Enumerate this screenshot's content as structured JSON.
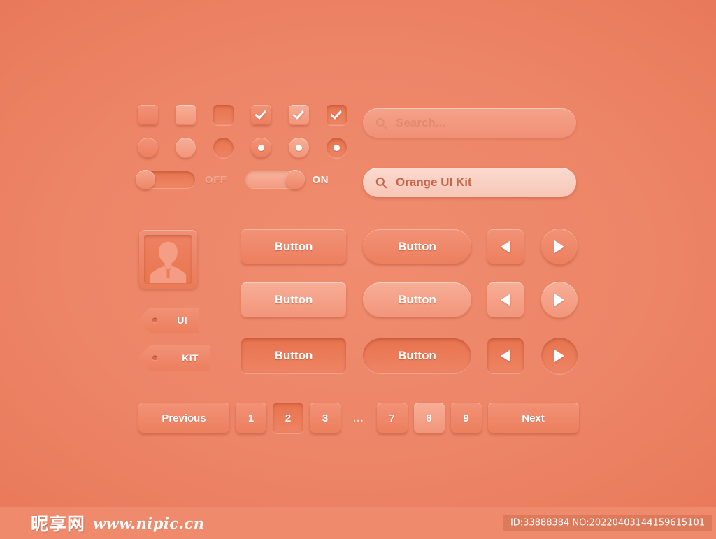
{
  "theme": {
    "background": "#ED8567",
    "surface_normal": "#F08B6D",
    "surface_light": "#F5A189",
    "surface_pressed": "#E8734F",
    "text_on_surface": "#FFFFFF",
    "text_muted": "#E08C72",
    "text_accent": "#C4654A",
    "field_filled_bg": "#FBDACF"
  },
  "controls": {
    "checkboxes": [
      {
        "name": "checkbox-unchecked-normal",
        "checked": false,
        "state": "normal"
      },
      {
        "name": "checkbox-unchecked-hover",
        "checked": false,
        "state": "light"
      },
      {
        "name": "checkbox-unchecked-pressed",
        "checked": false,
        "state": "pressed"
      },
      {
        "name": "checkbox-checked-normal",
        "checked": true,
        "state": "normal"
      },
      {
        "name": "checkbox-checked-hover",
        "checked": true,
        "state": "light"
      },
      {
        "name": "checkbox-checked-pressed",
        "checked": true,
        "state": "pressed"
      }
    ],
    "radios": [
      {
        "name": "radio-unselected-normal",
        "selected": false,
        "state": "normal"
      },
      {
        "name": "radio-unselected-hover",
        "selected": false,
        "state": "light"
      },
      {
        "name": "radio-unselected-pressed",
        "selected": false,
        "state": "pressed"
      },
      {
        "name": "radio-selected-normal",
        "selected": true,
        "state": "normal"
      },
      {
        "name": "radio-selected-hover",
        "selected": true,
        "state": "light"
      },
      {
        "name": "radio-selected-pressed",
        "selected": true,
        "state": "pressed"
      }
    ],
    "toggles": [
      {
        "name": "toggle-off",
        "label": "OFF",
        "on": false
      },
      {
        "name": "toggle-on",
        "label": "ON",
        "on": true
      }
    ]
  },
  "search_fields": [
    {
      "name": "search-placeholder",
      "value": "",
      "placeholder": "Search...",
      "icon": "search-icon",
      "state": "empty"
    },
    {
      "name": "search-filled",
      "value": "Orange UI Kit",
      "placeholder": "Search...",
      "icon": "search-icon",
      "state": "filled"
    }
  ],
  "avatar": {
    "name": "avatar",
    "icon": "user-silhouette-icon"
  },
  "tags": [
    {
      "name": "tag-ui",
      "label": "UI"
    },
    {
      "name": "tag-kit",
      "label": "KIT"
    }
  ],
  "buttons": {
    "label": "Button",
    "rows": [
      {
        "state": "normal",
        "rect_label": "Button",
        "pill_label": "Button"
      },
      {
        "state": "light",
        "rect_label": "Button",
        "pill_label": "Button"
      },
      {
        "state": "pressed",
        "rect_label": "Button",
        "pill_label": "Button"
      }
    ]
  },
  "arrow_buttons": {
    "prev_icon": "triangle-left-icon",
    "next_icon": "triangle-right-icon",
    "rows": [
      {
        "state": "normal"
      },
      {
        "state": "light"
      },
      {
        "state": "pressed"
      }
    ]
  },
  "pagination": {
    "previous_label": "Previous",
    "next_label": "Next",
    "ellipsis": "...",
    "pages": [
      {
        "label": "1",
        "state": "normal"
      },
      {
        "label": "2",
        "state": "pressed"
      },
      {
        "label": "3",
        "state": "normal"
      },
      {
        "label": "...",
        "state": "ellipsis"
      },
      {
        "label": "7",
        "state": "normal"
      },
      {
        "label": "8",
        "state": "light"
      },
      {
        "label": "9",
        "state": "normal"
      }
    ]
  },
  "footer": {
    "logo_text": "昵享网",
    "url": "www.nipic.cn",
    "id_badge": "ID:33888384 NO:20220403144159615101"
  }
}
